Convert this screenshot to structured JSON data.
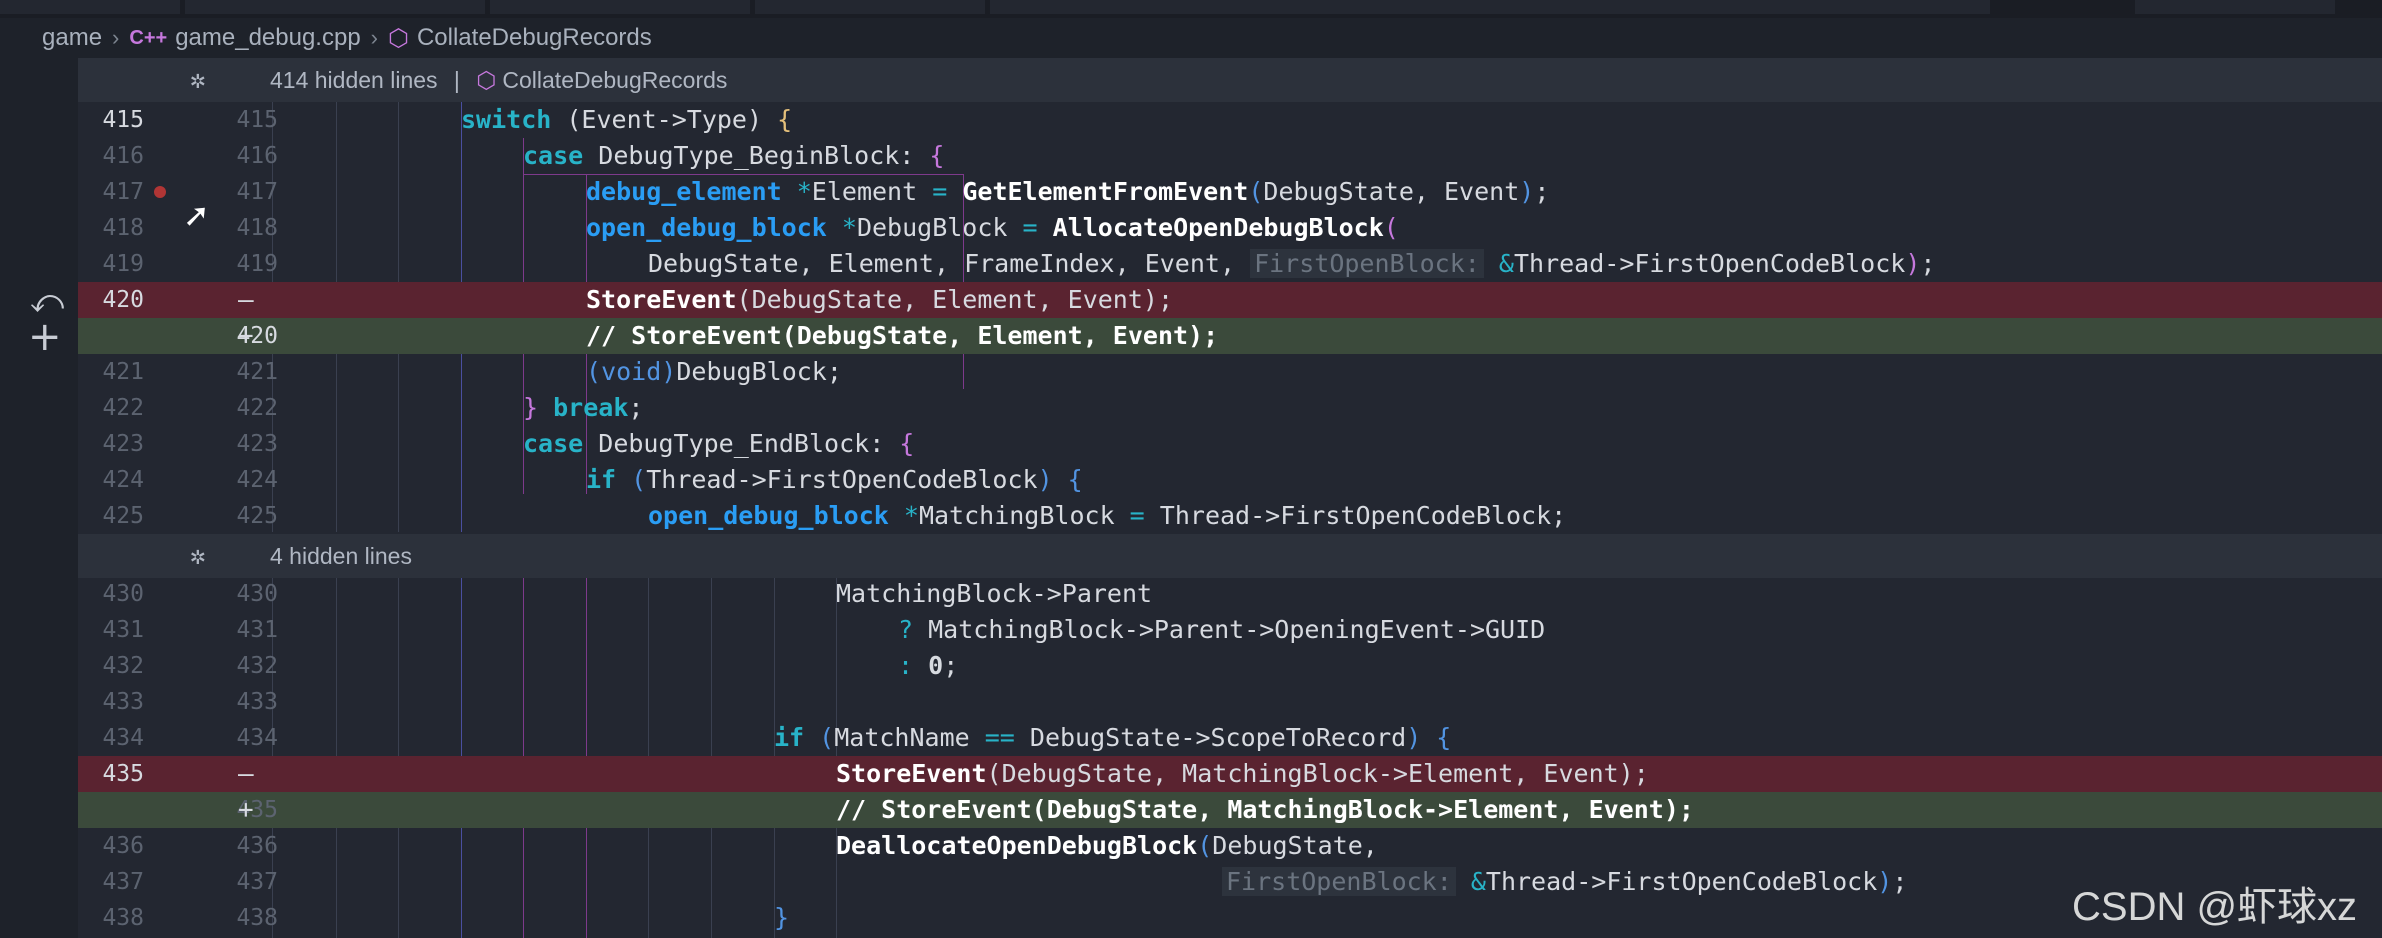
{
  "breadcrumb": {
    "folder": "game",
    "file_icon": "C++",
    "file": "game_debug.cpp",
    "symbol_icon": "cube-icon",
    "symbol": "CollateDebugRecords"
  },
  "fold1": {
    "label": "414 hidden lines",
    "divider": "|",
    "symbol": "CollateDebugRecords"
  },
  "fold2": {
    "label": "4 hidden lines"
  },
  "lines": [
    {
      "l": "415",
      "r": "415"
    },
    {
      "l": "416",
      "r": "416"
    },
    {
      "l": "417",
      "r": "417"
    },
    {
      "l": "418",
      "r": "418"
    },
    {
      "l": "419",
      "r": "419"
    },
    {
      "l": "420",
      "r": "",
      "mark": "—"
    },
    {
      "l": "",
      "r": "420",
      "mark": "+"
    },
    {
      "l": "421",
      "r": "421"
    },
    {
      "l": "422",
      "r": "422"
    },
    {
      "l": "423",
      "r": "423"
    },
    {
      "l": "424",
      "r": "424"
    },
    {
      "l": "425",
      "r": "425"
    },
    {
      "l": "430",
      "r": "430"
    },
    {
      "l": "431",
      "r": "431"
    },
    {
      "l": "432",
      "r": "432"
    },
    {
      "l": "433",
      "r": "433"
    },
    {
      "l": "434",
      "r": "434"
    },
    {
      "l": "435",
      "r": "",
      "mark": "—"
    },
    {
      "l": "",
      "r": "435",
      "mark": "+"
    },
    {
      "l": "436",
      "r": "436"
    },
    {
      "l": "437",
      "r": "437"
    },
    {
      "l": "438",
      "r": "438"
    }
  ],
  "code": {
    "c415": [
      "switch",
      " (",
      "Event->Type",
      ") ",
      "{"
    ],
    "c416": [
      "case",
      " DebugType_BeginBlock: ",
      "{"
    ],
    "c417": [
      "debug_element",
      " ",
      "*",
      "Element ",
      "=",
      " ",
      "GetElementFromEvent",
      "(",
      "DebugState, Event",
      ")",
      ";"
    ],
    "c418": [
      "open_debug_block",
      " ",
      "*",
      "DebugBlock ",
      "=",
      " ",
      "AllocateOpenDebugBlock",
      "("
    ],
    "c419": [
      "DebugState, Element, FrameIndex, Event, ",
      "FirstOpenBlock:",
      " ",
      "&",
      "Thread->FirstOpenCodeBlock",
      ")",
      ";"
    ],
    "c420d": [
      "StoreEvent",
      "(DebugState, Element, Event);"
    ],
    "c420a": [
      "// StoreEvent(DebugState, Element, Event);"
    ],
    "c421": [
      "(",
      "void",
      ")",
      "DebugBlock;"
    ],
    "c422": [
      "}",
      " ",
      "break",
      ";"
    ],
    "c423": [
      "case",
      " DebugType_EndBlock: ",
      "{"
    ],
    "c424": [
      "if",
      " (",
      "Thread->FirstOpenCodeBlock",
      ") ",
      "{"
    ],
    "c425": [
      "open_debug_block",
      " ",
      "*",
      "MatchingBlock ",
      "=",
      " Thread->FirstOpenCodeBlock;"
    ],
    "c430": [
      "MatchingBlock->Parent"
    ],
    "c431": [
      "?",
      " MatchingBlock->Parent->OpeningEvent->GUID"
    ],
    "c432": [
      ":",
      " ",
      "0",
      ";"
    ],
    "c434": [
      "if",
      " (",
      "MatchName ",
      "==",
      " DebugState->ScopeToRecord",
      ") ",
      "{"
    ],
    "c435d": [
      "StoreEvent",
      "(DebugState, MatchingBlock->Element, Event);"
    ],
    "c435a": [
      "// StoreEvent(DebugState, MatchingBlock->Element, Event);"
    ],
    "c436": [
      "DeallocateOpenDebugBlock",
      "(",
      "DebugState,"
    ],
    "c437": [
      "FirstOpenBlock:",
      " ",
      "&",
      "Thread->FirstOpenCodeBlock",
      ")",
      ";"
    ],
    "c438": [
      "}"
    ]
  },
  "watermark": "CSDN @虾球xz",
  "colors": {
    "keyword": "#28b3c8",
    "type": "#2a9df4",
    "function": "#ffffff",
    "deleted_row": "#5a2330",
    "added_row": "#3b4a3b",
    "editor_bg": "#232731"
  }
}
